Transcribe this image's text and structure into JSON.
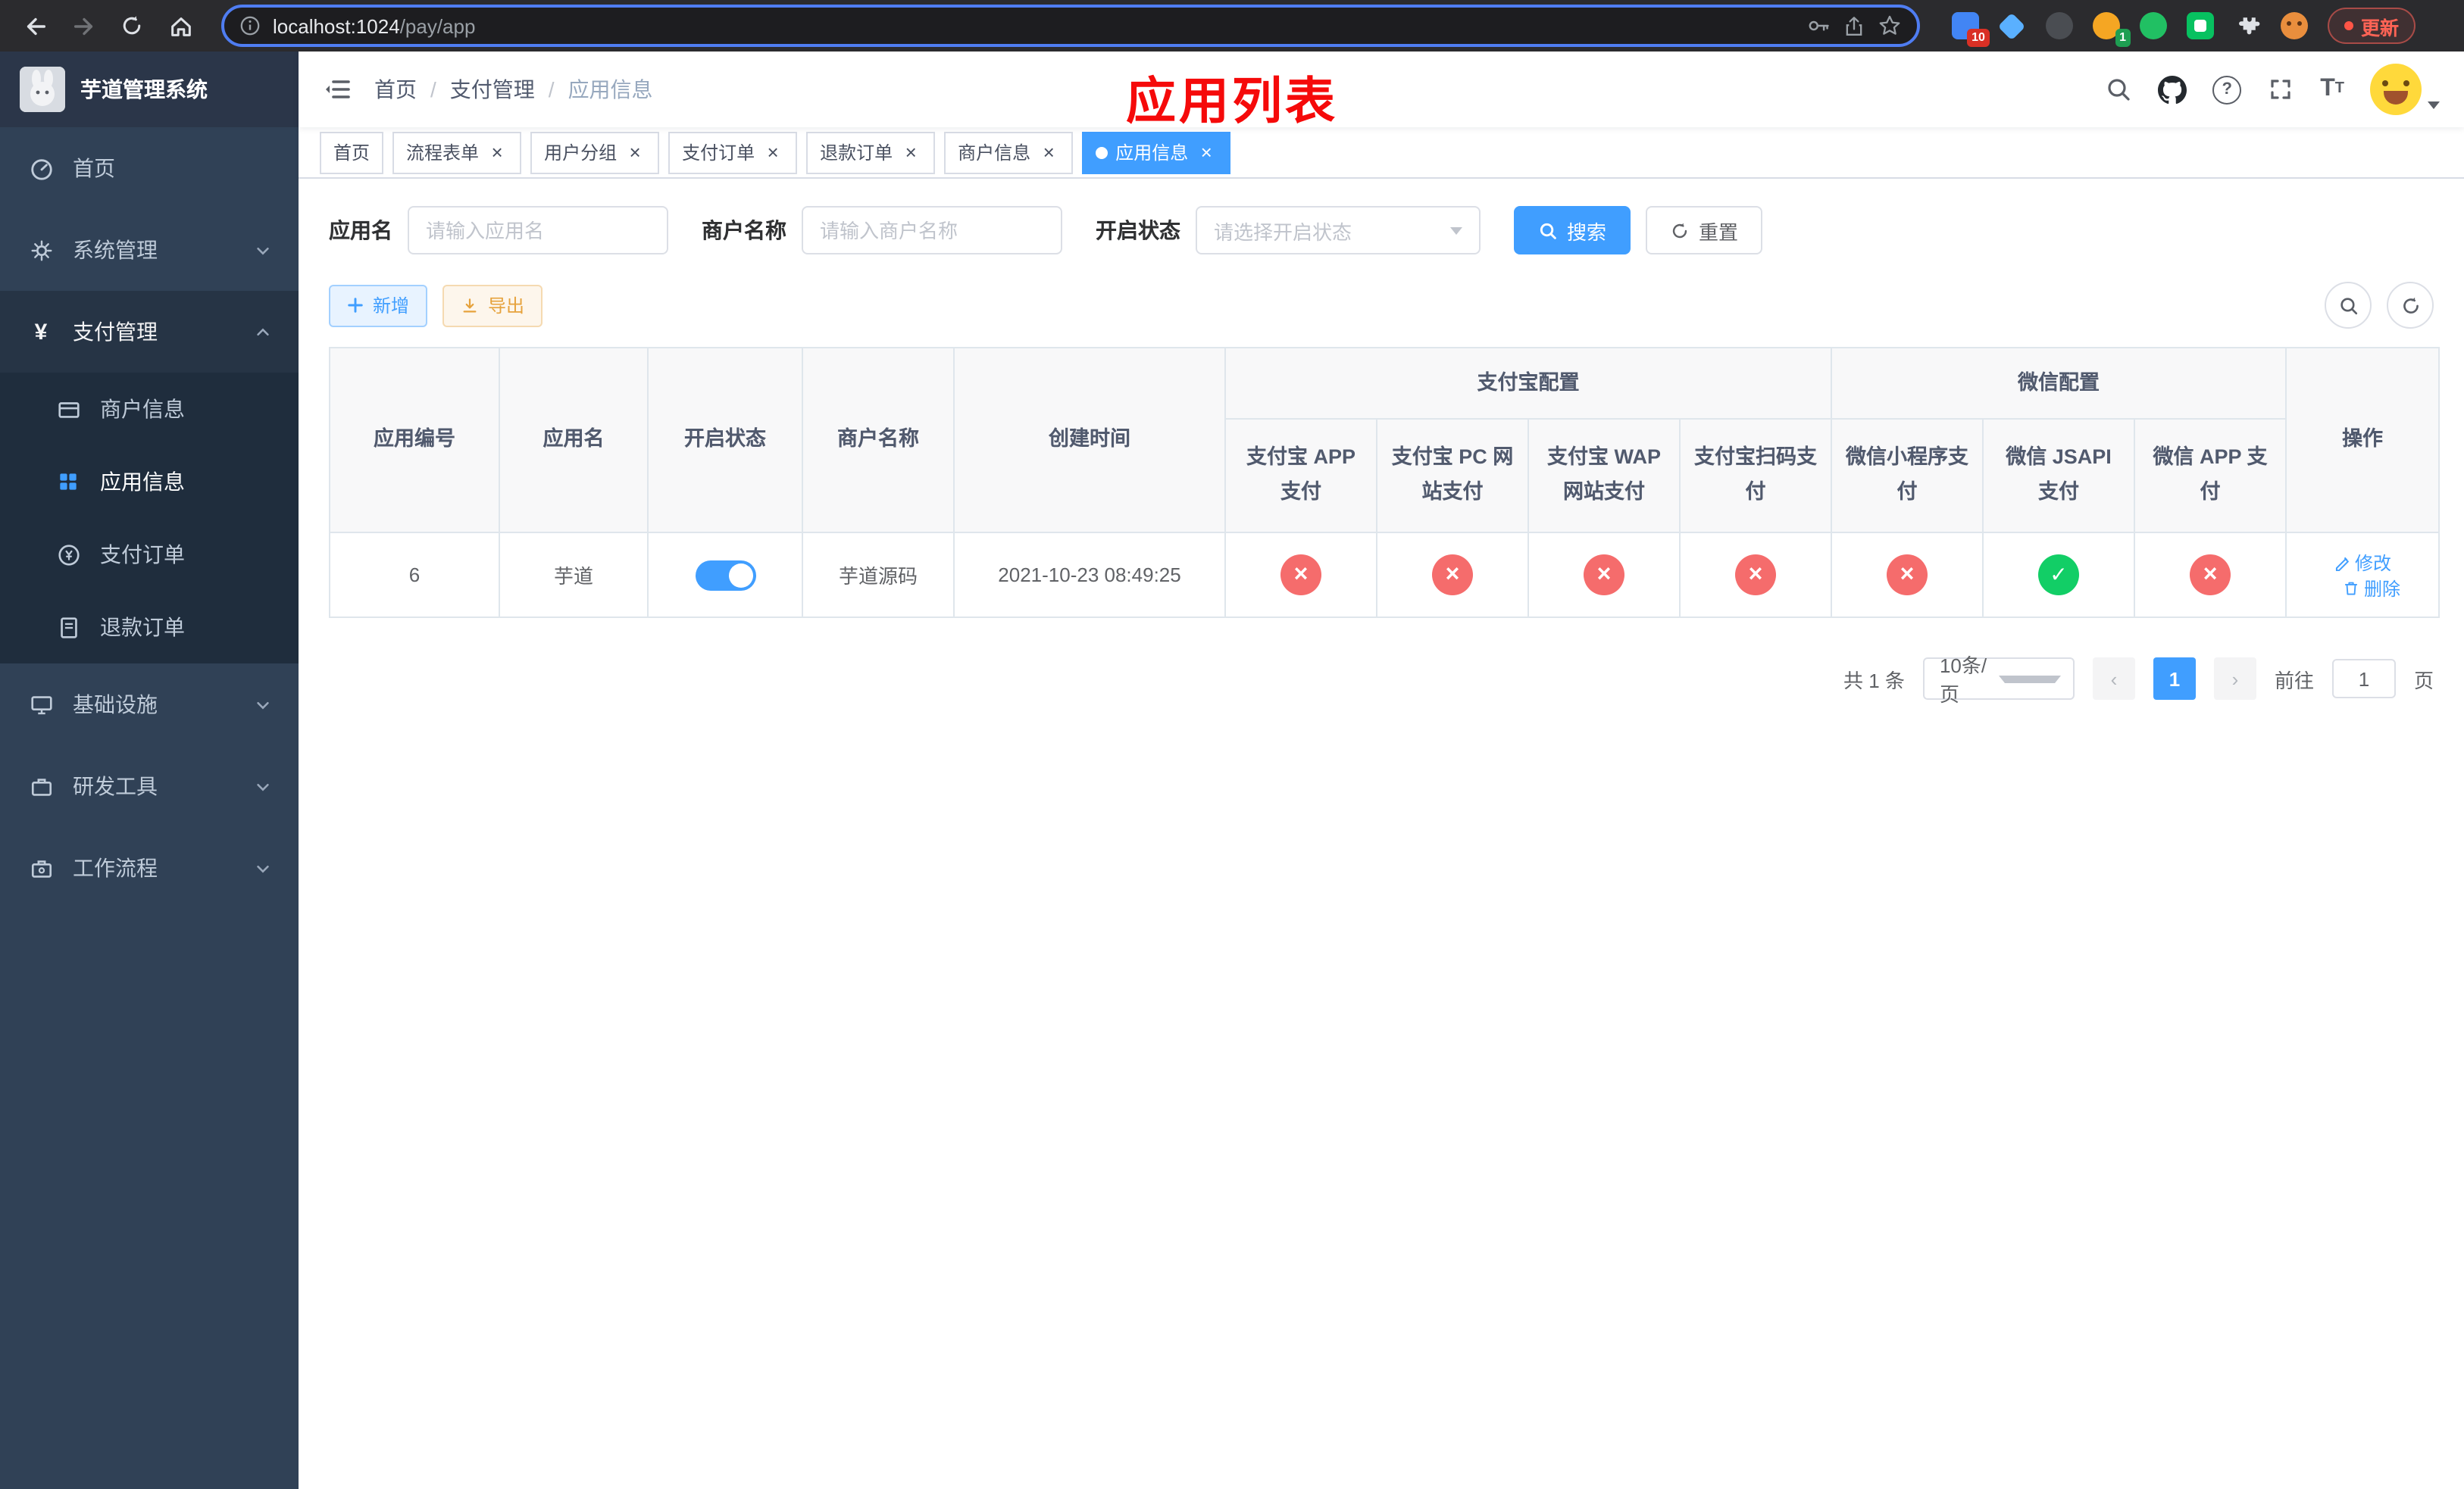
{
  "colors": {
    "accent": "#409eff",
    "danger": "#f56c6c",
    "success": "#12ce66",
    "title_red": "#f50a0a",
    "sidebar_bg": "#304156",
    "submenu_bg": "#1f2d3d"
  },
  "browser": {
    "url_host": "localhost:1024",
    "url_path": "/pay/app",
    "update_label": "更新",
    "ext_badge_red": "10",
    "ext_badge_green": "1"
  },
  "sidebar": {
    "title": "芋道管理系统",
    "items": [
      {
        "label": "首页"
      },
      {
        "label": "系统管理"
      },
      {
        "label": "支付管理"
      },
      {
        "label": "基础设施"
      },
      {
        "label": "研发工具"
      },
      {
        "label": "工作流程"
      }
    ],
    "payment_children": [
      {
        "label": "商户信息"
      },
      {
        "label": "应用信息"
      },
      {
        "label": "支付订单"
      },
      {
        "label": "退款订单"
      }
    ]
  },
  "header": {
    "breadcrumb": [
      "首页",
      "支付管理",
      "应用信息"
    ],
    "separator": "/",
    "page_title": "应用列表"
  },
  "tabs": [
    {
      "label": "首页"
    },
    {
      "label": "流程表单"
    },
    {
      "label": "用户分组"
    },
    {
      "label": "支付订单"
    },
    {
      "label": "退款订单"
    },
    {
      "label": "商户信息"
    },
    {
      "label": "应用信息"
    }
  ],
  "icons": {
    "close_glyph": "×",
    "question_glyph": "?",
    "prev_glyph": "‹",
    "next_glyph": "›",
    "big_t": "T",
    "small_t": "T",
    "info_glyph": "i"
  },
  "filters": {
    "app_name_label": "应用名",
    "app_name_placeholder": "请输入应用名",
    "merchant_label": "商户名称",
    "merchant_placeholder": "请输入商户名称",
    "status_label": "开启状态",
    "status_placeholder": "请选择开启状态",
    "search_label": "搜索",
    "reset_label": "重置"
  },
  "toolbar": {
    "add_label": "新增",
    "export_label": "导出"
  },
  "table": {
    "headers": {
      "app_id": "应用编号",
      "app_name": "应用名",
      "status": "开启状态",
      "merchant": "商户名称",
      "created": "创建时间",
      "alipay_group": "支付宝配置",
      "wechat_group": "微信配置",
      "alipay_app": "支付宝 APP 支付",
      "alipay_pc": "支付宝 PC 网站支付",
      "alipay_wap": "支付宝 WAP 网站支付",
      "alipay_qr": "支付宝扫码支付",
      "wx_mini": "微信小程序支付",
      "wx_jsapi": "微信 JSAPI 支付",
      "wx_app": "微信 APP 支付",
      "actions": "操作"
    },
    "rows": [
      {
        "app_id": "6",
        "app_name": "芋道",
        "status_on": "true",
        "merchant": "芋道源码",
        "created": "2021-10-23 08:49:25",
        "configs": [
          "x",
          "x",
          "x",
          "x",
          "x",
          "check",
          "x"
        ],
        "edit_label": "修改",
        "delete_label": "删除"
      }
    ]
  },
  "pagination": {
    "total": "共 1 条",
    "page_size": "10条/页",
    "current_page": "1",
    "goto_label": "前往",
    "goto_value": "1",
    "unit_label": "页"
  }
}
